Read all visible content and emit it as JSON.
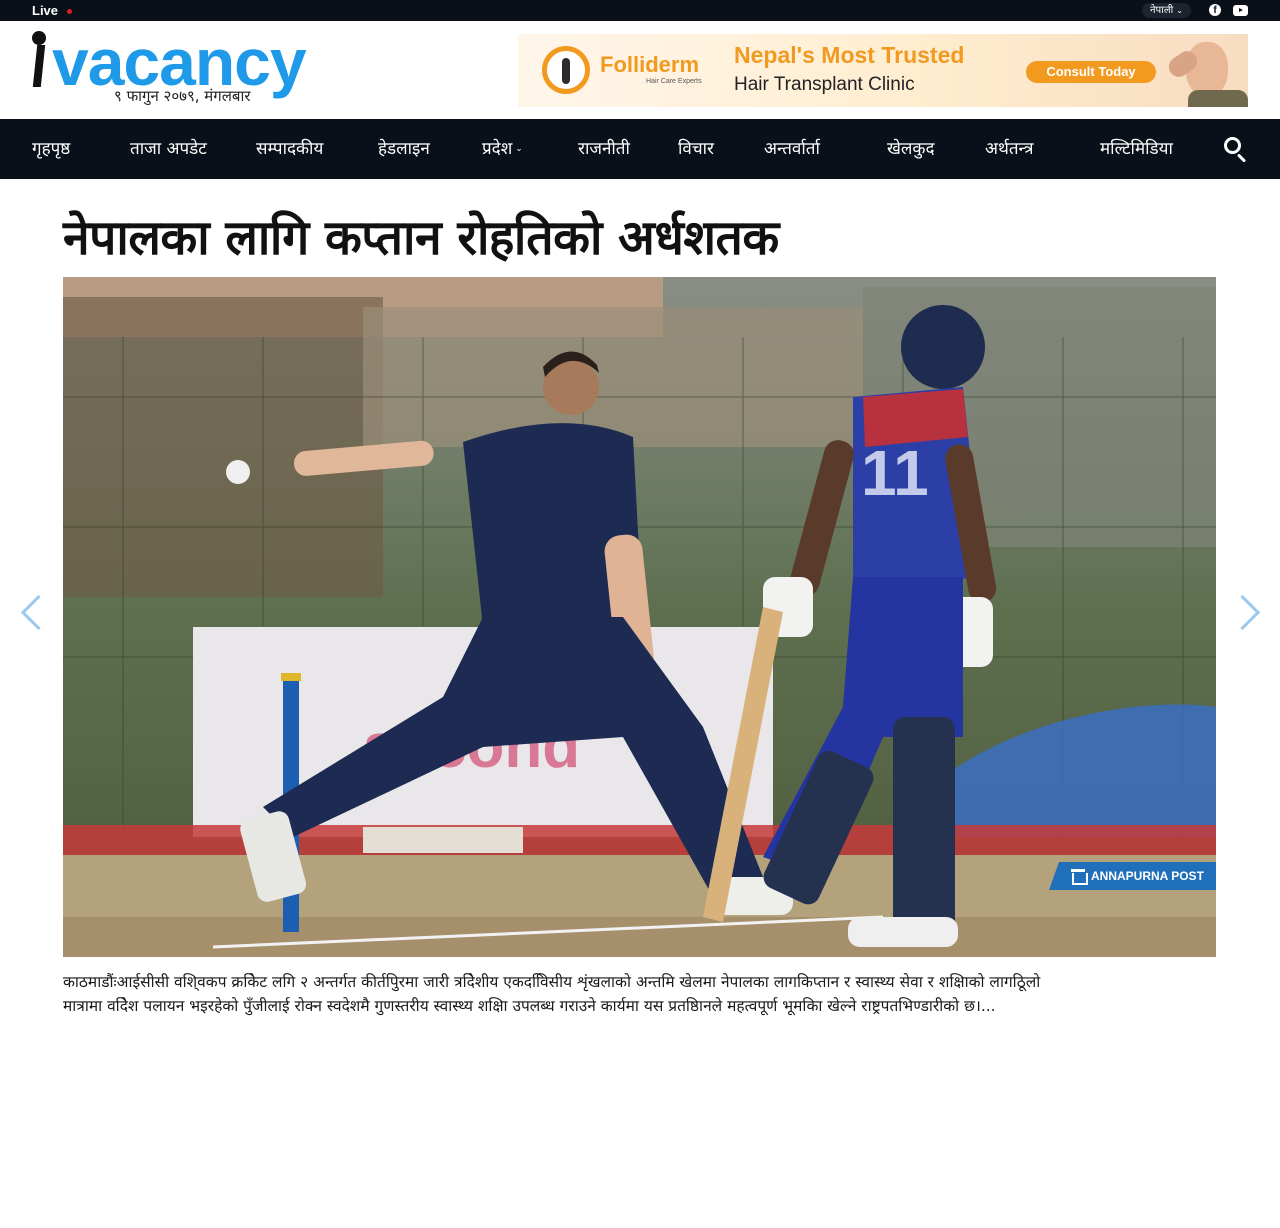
{
  "topbar": {
    "live_label": "Live",
    "language_label": "नेपाली",
    "social": [
      "facebook-icon",
      "youtube-icon"
    ]
  },
  "header": {
    "logo_text": "vacancy",
    "date": "९ फागुन २०७९, मंगलबार"
  },
  "ad": {
    "brand": "Folliderm",
    "brand_tagline": "Hair Care Experts",
    "headline": "Nepal's Most Trusted",
    "subline": "Hair Transplant Clinic",
    "cta": "Consult Today"
  },
  "nav": {
    "items": [
      {
        "label": "गृहपृष्ठ"
      },
      {
        "label": "ताजा अपडेट"
      },
      {
        "label": "सम्पादकीय"
      },
      {
        "label": "हेडलाइन"
      },
      {
        "label": "प्रदेश",
        "has_dropdown": true
      },
      {
        "label": "राजनीती"
      },
      {
        "label": "विचार"
      },
      {
        "label": "अन्तर्वार्ता"
      },
      {
        "label": "खेलकुद"
      },
      {
        "label": "अर्थतन्त्र"
      },
      {
        "label": "मल्टिमिडिया"
      }
    ],
    "search_icon": "search-icon"
  },
  "article": {
    "headline": "नेपालका लागि कप्तान रोहतिको अर्धशतक",
    "photo_credit": "ANNAPURNA POST",
    "excerpt_line1": "काठमाडौंःआईसीसी वशि्वकप क्रकिेट लगि २ अन्तर्गत कीर्तपिुरमा जारी त्रदिेशीय एकदवििसीय शृंखलाको अन्तमि खेलमा नेपालका लागकिप्तान र स्वास्थ्य सेवा र शक्षिाको लागठिूलो",
    "excerpt_line2": "मात्रामा वदिेश पलायन भइरहेको पुँजीलाई रोक्न स्वदेशमै गुणस्तरीय स्वास्थ्य शक्षिा उपलब्ध गराउने कार्यमा यस प्रतष्ठिानले महत्वपूर्ण भूमकिा खेल्ने राष्ट्रपतभिण्डारीको  छ।..."
  },
  "colors": {
    "topbar_bg": "#0a1019",
    "brand_blue": "#1f9ae8",
    "ad_orange": "#f29a1f",
    "arrow": "#9cc9ee"
  }
}
